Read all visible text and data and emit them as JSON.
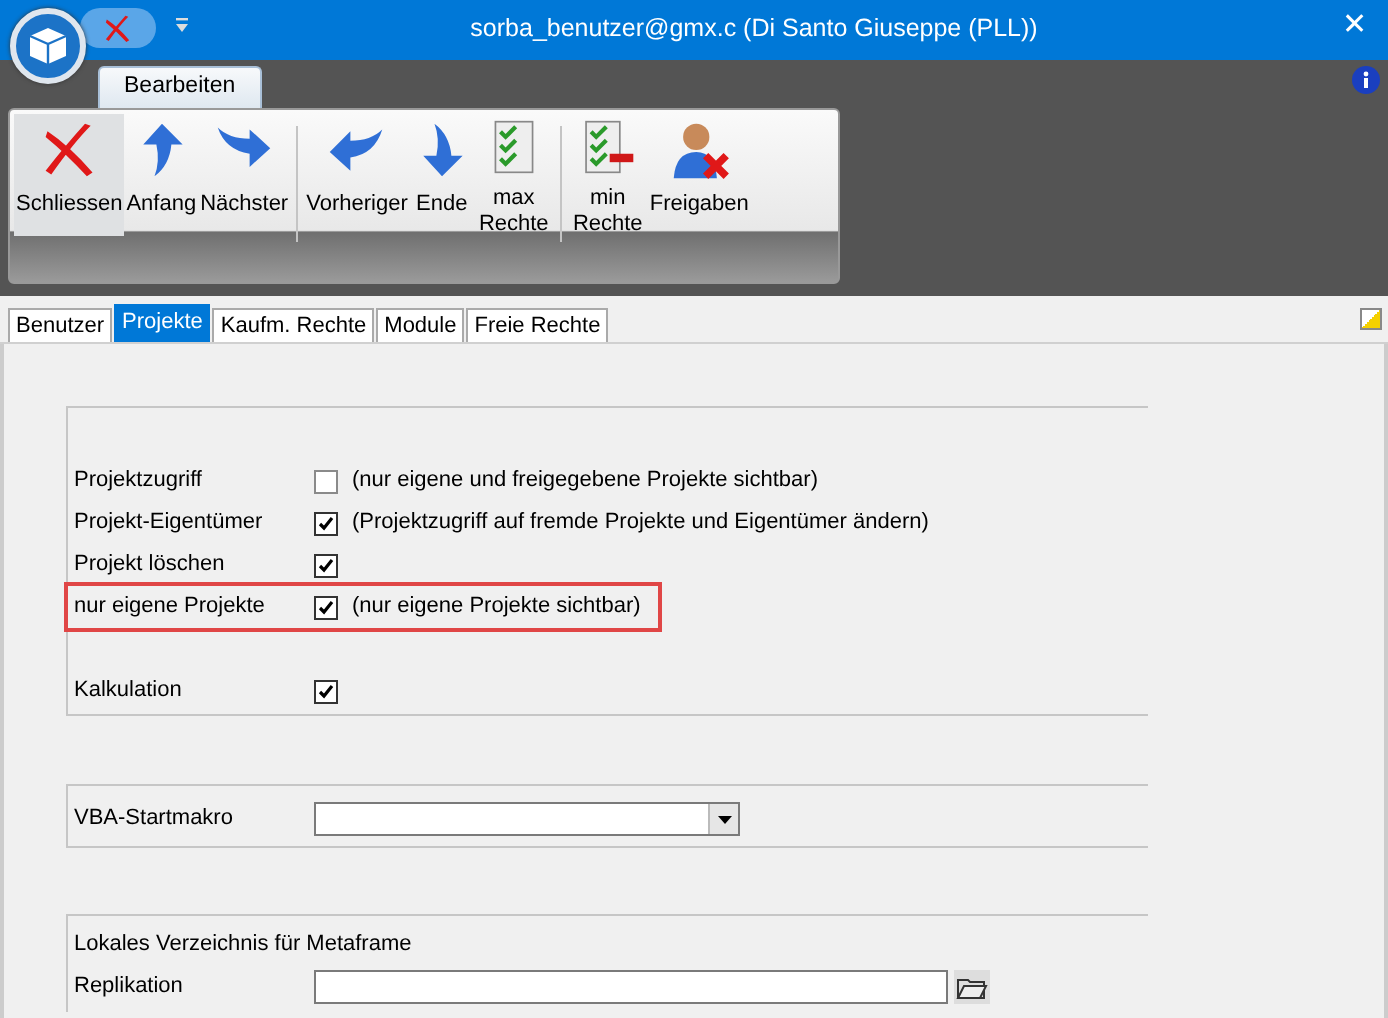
{
  "window": {
    "title": "sorba_benutzer@gmx.c (Di Santo Giuseppe (PLL))",
    "close": "✕"
  },
  "ribbon_tabs": [
    {
      "label": "Bearbeiten",
      "selected": true
    }
  ],
  "toolbar": [
    {
      "label": "Schliessen",
      "active": true
    },
    {
      "label": "Anfang",
      "active": false
    },
    {
      "label": "Nächster",
      "active": false
    },
    {
      "label": "Vorheriger",
      "active": false
    },
    {
      "label": "Ende",
      "active": false
    },
    {
      "label": "max Rechte",
      "active": false
    },
    {
      "label": "min Rechte",
      "active": false
    },
    {
      "label": "Freigaben",
      "active": false
    }
  ],
  "tabs": [
    {
      "label": "Benutzer",
      "selected": false
    },
    {
      "label": "Projekte",
      "selected": true
    },
    {
      "label": "Kaufm. Rechte",
      "selected": false
    },
    {
      "label": "Module",
      "selected": false
    },
    {
      "label": "Freie Rechte",
      "selected": false
    }
  ],
  "permissions": [
    {
      "label": "Projektzugriff",
      "checked": false,
      "note": "(nur eigene und freigegebene Projekte sichtbar)",
      "highlighted": false
    },
    {
      "label": "Projekt-Eigentümer",
      "checked": true,
      "note": "(Projektzugriff auf fremde Projekte und Eigentümer ändern)",
      "highlighted": false
    },
    {
      "label": "Projekt löschen",
      "checked": true,
      "highlighted": false
    },
    {
      "label": "nur eigene Projekte",
      "checked": true,
      "note": "(nur eigene Projekte sichtbar)",
      "highlighted": true
    },
    {
      "label": "Kalkulation",
      "checked": true,
      "highlighted": false
    }
  ],
  "vba": {
    "label": "VBA-Startmakro"
  },
  "local_dir": {
    "heading": "Lokales Verzeichnis für Metaframe",
    "label": "Replikation"
  }
}
